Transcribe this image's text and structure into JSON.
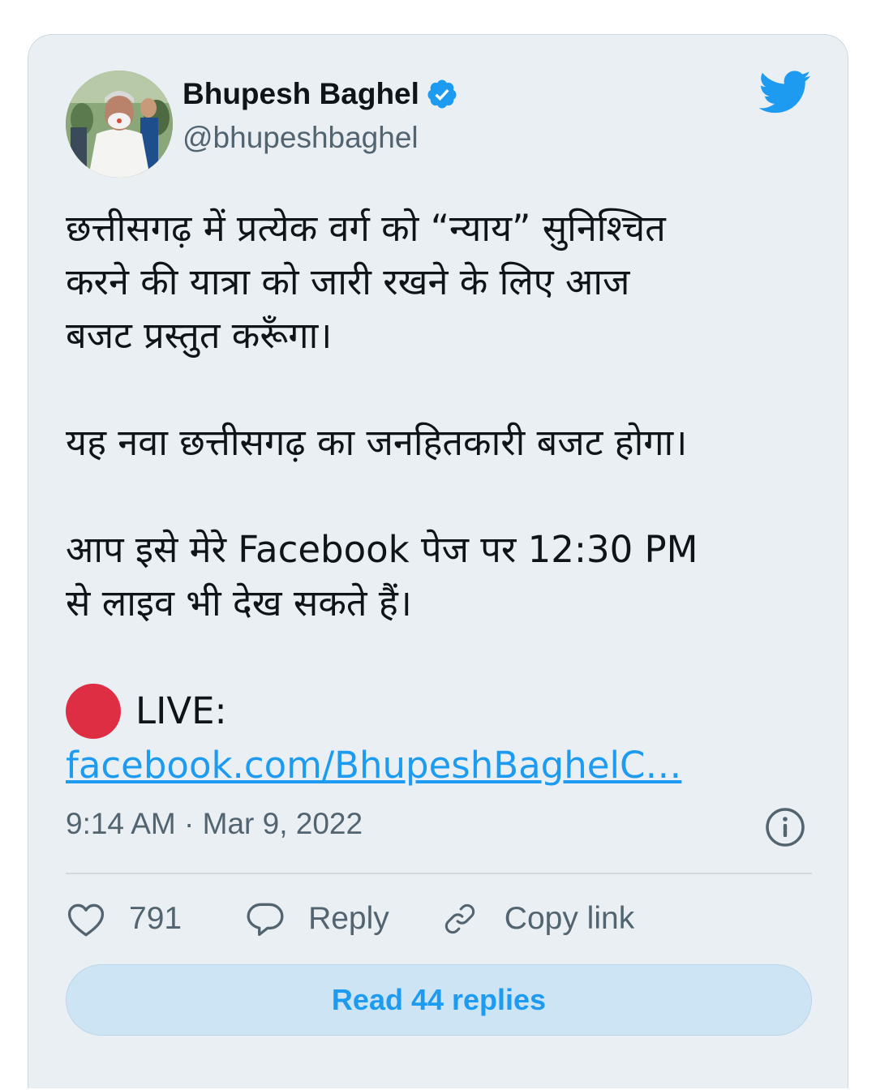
{
  "author": {
    "name": "Bhupesh Baghel",
    "handle": "@bhupeshbaghel",
    "verified": true
  },
  "tweet": {
    "paragraph_1": "छत्तीसगढ़ में प्रत्येक वर्ग को “न्याय” सुनिश्चित\nकरने की यात्रा को जारी रखने के लिए आज\nबजट प्रस्तुत करूँगा।",
    "paragraph_2": "यह नवा छत्तीसगढ़ का जनहितकारी बजट होगा।",
    "paragraph_3": "आप इसे मेरे Facebook पेज पर 12:30 PM\nसे लाइव भी देख सकते हैं।",
    "live_label": "LIVE:",
    "link_text": "facebook.com/BhupeshBaghelC…"
  },
  "timestamp": "9:14 AM · Mar 9, 2022",
  "actions": {
    "like_count": "791",
    "reply_label": "Reply",
    "copy_link_label": "Copy link"
  },
  "read_replies_label": "Read 44 replies",
  "icons": {
    "brand": "twitter-bird-icon",
    "verified": "verified-badge-icon",
    "info": "info-icon",
    "like": "heart-icon",
    "reply": "speech-bubble-icon",
    "copy": "link-icon",
    "live": "red-circle-emoji"
  },
  "colors": {
    "brand_blue": "#1d9bf0",
    "card_bg": "#e9eff3",
    "muted_text": "#536471",
    "primary_text": "#0f1419",
    "live_red": "#dd2e44"
  }
}
